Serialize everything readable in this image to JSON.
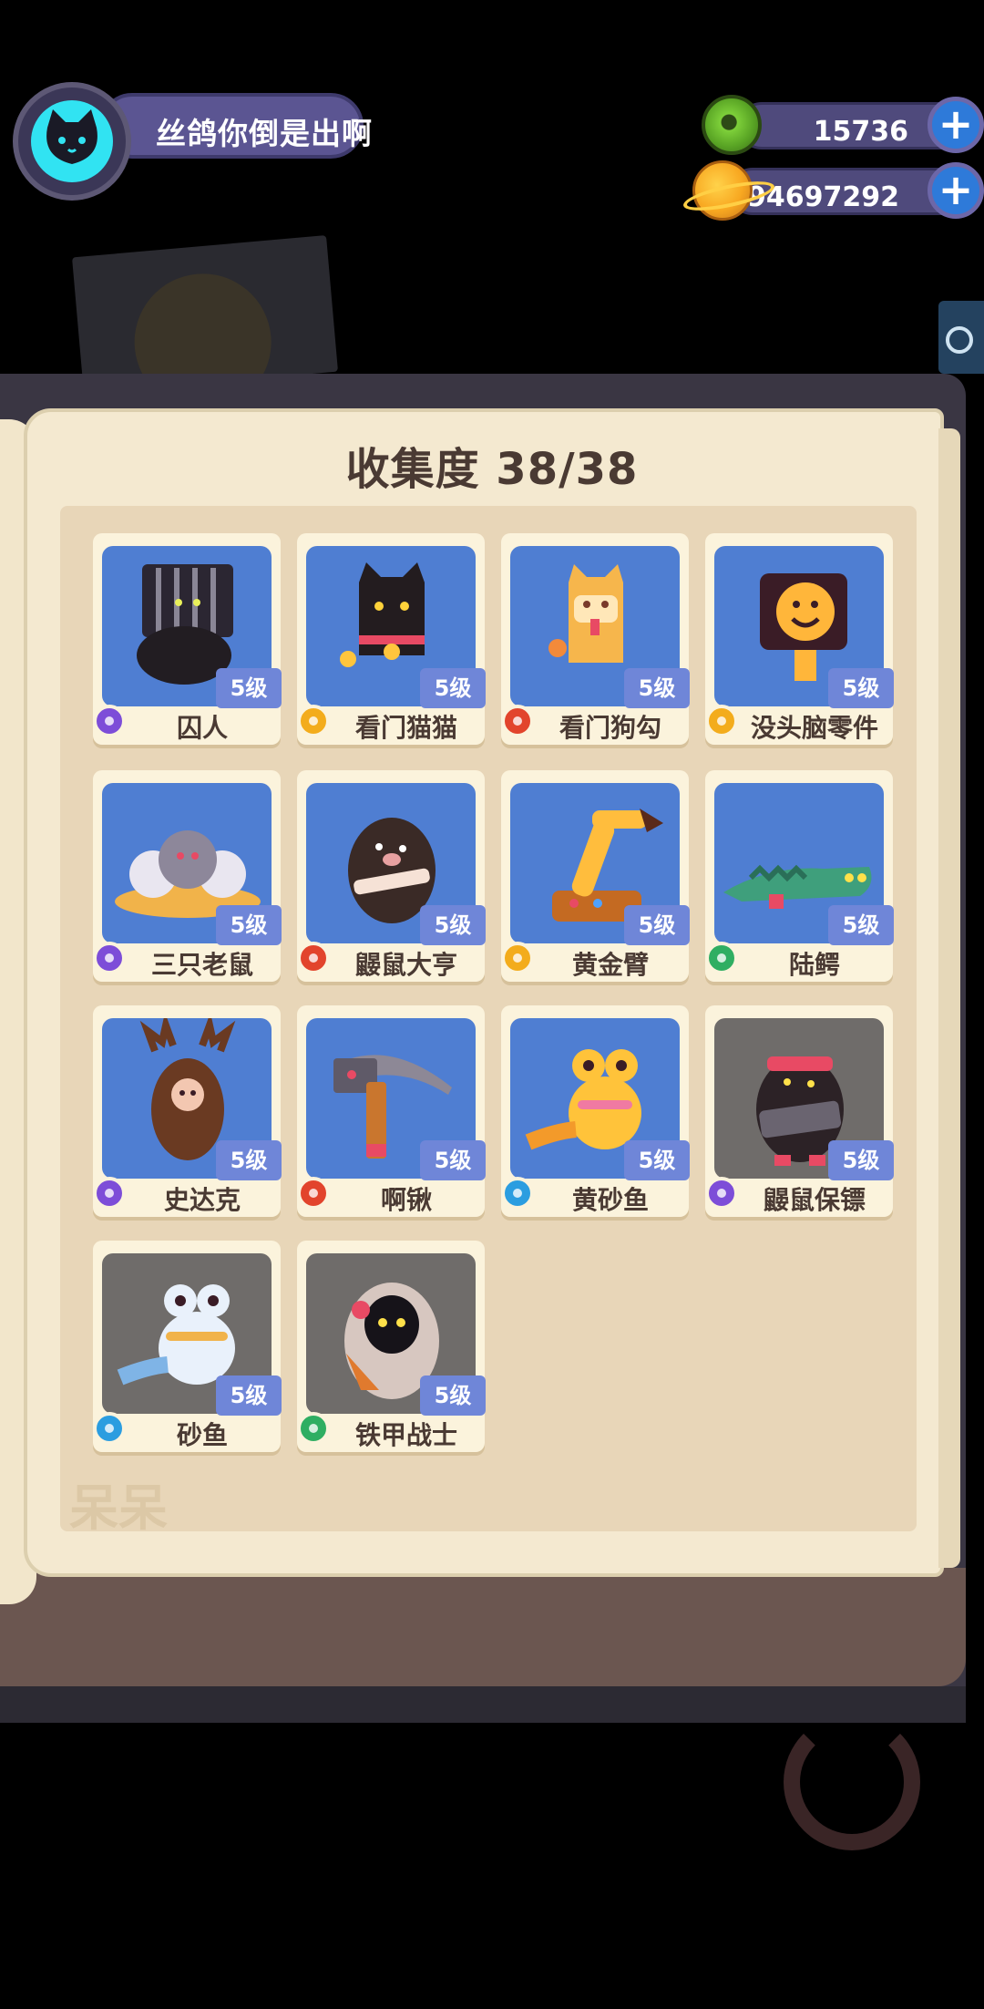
{
  "profile": {
    "name": "丝鸽你倒是出啊"
  },
  "currencies": [
    {
      "icon": "green-gem-coin-icon",
      "amount": "15736"
    },
    {
      "icon": "gold-planet-coin-icon",
      "amount": "94697292"
    }
  ],
  "collection": {
    "title": "收集度 38/38",
    "watermark": "呆呆"
  },
  "cards": [
    {
      "name": "囚人",
      "level": "5级",
      "rarity": "purple",
      "art": "gray-silhouette"
    },
    {
      "name": "看门猫猫",
      "level": "5级",
      "rarity": "gold",
      "art": "black-cat"
    },
    {
      "name": "看门狗勾",
      "level": "5级",
      "rarity": "red",
      "art": "orange-dog"
    },
    {
      "name": "没头脑零件",
      "level": "5级",
      "rarity": "gold",
      "art": "smiley-block"
    },
    {
      "name": "三只老鼠",
      "level": "5级",
      "rarity": "purple",
      "art": "three-mice"
    },
    {
      "name": "鼹鼠大亨",
      "level": "5级",
      "rarity": "red",
      "art": "mole"
    },
    {
      "name": "黄金臂",
      "level": "5级",
      "rarity": "gold",
      "art": "golden-arm"
    },
    {
      "name": "陆鳄",
      "level": "5级",
      "rarity": "green",
      "art": "croc"
    },
    {
      "name": "史达克",
      "level": "5级",
      "rarity": "purple",
      "art": "moose"
    },
    {
      "name": "啊锹",
      "level": "5级",
      "rarity": "red",
      "art": "pickaxe"
    },
    {
      "name": "黄砂鱼",
      "level": "5级",
      "rarity": "blue",
      "art": "yellow-frog"
    },
    {
      "name": "鼹鼠保镖",
      "level": "5级",
      "rarity": "purple",
      "art": "mole-guard",
      "gray": true
    },
    {
      "name": "砂鱼",
      "level": "5级",
      "rarity": "blue",
      "art": "white-frog",
      "gray": true
    },
    {
      "name": "铁甲战士",
      "level": "5级",
      "rarity": "green",
      "art": "armor-warrior",
      "gray": true
    }
  ],
  "colors": {
    "card_art_blue": "#4f7ed2",
    "card_art_gray": "#6f6c6a",
    "level_badge": "#6f86d8",
    "page": "#f4e9d0"
  }
}
